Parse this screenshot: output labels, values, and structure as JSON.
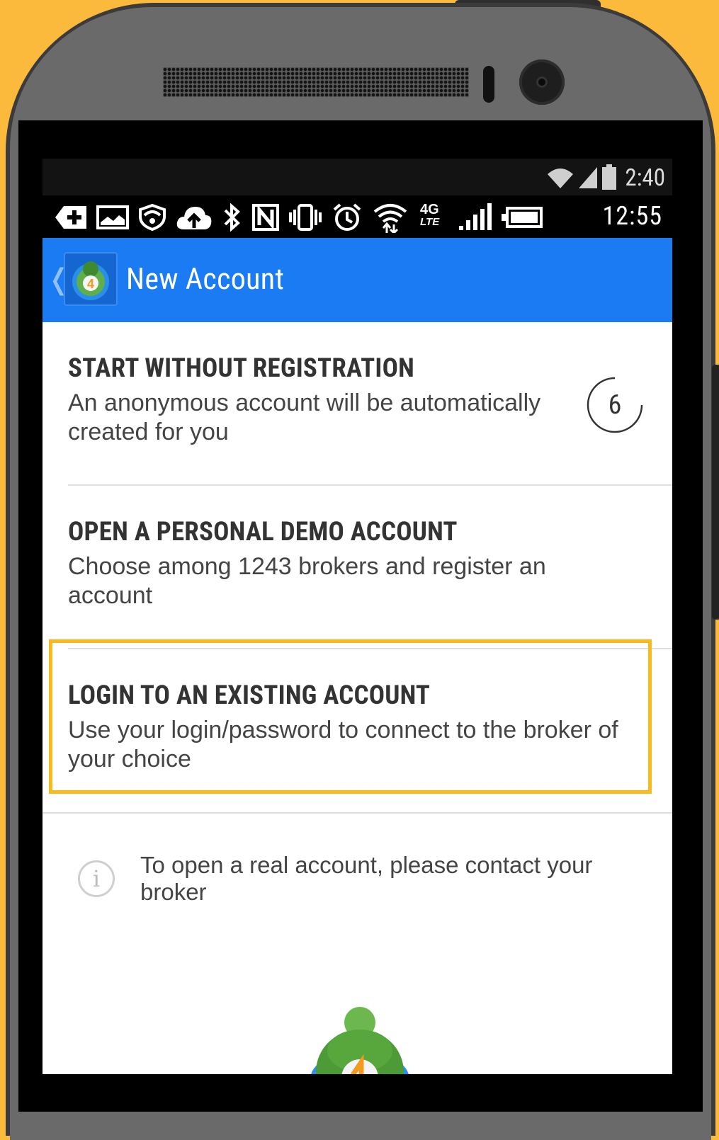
{
  "status_bar_secondary": {
    "time": "2:40"
  },
  "status_bar": {
    "time": "12:55",
    "network_label": "4G",
    "network_sub": "LTE"
  },
  "app_bar": {
    "title": "New Account",
    "back_glyph": "❬"
  },
  "options": [
    {
      "title": "START WITHOUT REGISTRATION",
      "subtitle_line1": "An anonymous account will be automatically",
      "subtitle_line2": "created for you",
      "countdown": "6"
    },
    {
      "title": "OPEN A PERSONAL DEMO ACCOUNT",
      "subtitle_line1": "Choose among 1243 brokers and register an",
      "subtitle_line2": "account"
    },
    {
      "title": "LOGIN TO AN EXISTING ACCOUNT",
      "subtitle_line1": "Use your login/password to connect to the broker of",
      "subtitle_line2": "your choice"
    }
  ],
  "info": {
    "glyph": "i",
    "line1": "To open a real account, please contact your",
    "line2": "broker"
  },
  "colors": {
    "background": "#FBBA3C",
    "app_bar": "#1B7BF2",
    "highlight": "#FBBA1B"
  },
  "app_logo_badge": "4"
}
